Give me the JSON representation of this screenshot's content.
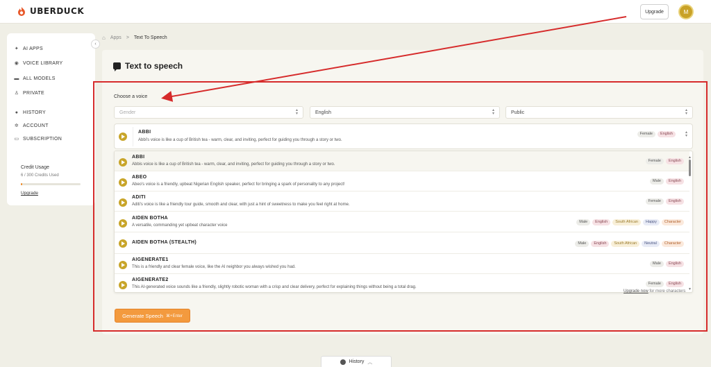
{
  "app": {
    "name": "UBERDUCK"
  },
  "topbar": {
    "upgrade_label": "Upgrade",
    "avatar_initial": "M"
  },
  "sidebar": {
    "items": [
      {
        "label": "AI APPS",
        "icon": "sparkle-icon"
      },
      {
        "label": "VOICE LIBRARY",
        "icon": "eye-icon"
      },
      {
        "label": "ALL MODELS",
        "icon": "folder-icon"
      },
      {
        "label": "PRIVATE",
        "icon": "user-icon"
      },
      {
        "label": "HISTORY",
        "icon": "clock-icon"
      },
      {
        "label": "ACCOUNT",
        "icon": "gear-icon"
      },
      {
        "label": "SUBSCRIPTION",
        "icon": "card-icon"
      }
    ],
    "credit_title": "Credit Usage",
    "credit_used": "6 / 300 Credits Used",
    "credit_fraction": 0.02,
    "upgrade_link": "Upgrade"
  },
  "breadcrumb": {
    "root": "Apps",
    "separator": ">",
    "current": "Text To Speech"
  },
  "page": {
    "title": "Text to speech",
    "choose_voice_label": "Choose a voice"
  },
  "filters": {
    "gender": {
      "placeholder": "Gender"
    },
    "language": {
      "value": "English"
    },
    "visibility": {
      "value": "Public"
    }
  },
  "selected_voice": {
    "name": "ABBI",
    "description": "Abbi's voice is like a cup of British tea - warm, clear, and inviting, perfect for guiding you through a story or two.",
    "tags": [
      {
        "text": "Female",
        "kind": "gender"
      },
      {
        "text": "English",
        "kind": "lang"
      }
    ]
  },
  "voices": [
    {
      "name": "ABBI",
      "description": "Abbis voice is like a cup of British tea - warm, clear, and inviting, perfect for guiding you through a story or two.",
      "tags": [
        {
          "text": "Female",
          "kind": "gender"
        },
        {
          "text": "English",
          "kind": "lang"
        }
      ]
    },
    {
      "name": "ABEO",
      "description": "Abeo's voice is a friendly, upbeat Nigerian English speaker, perfect for bringing a spark of personality to any project!",
      "tags": [
        {
          "text": "Male",
          "kind": "gender"
        },
        {
          "text": "English",
          "kind": "lang"
        }
      ]
    },
    {
      "name": "ADITI",
      "description": "Aditi's voice is like a friendly tour guide, smooth and clear, with just a hint of sweetness to make you feel right at home.",
      "tags": [
        {
          "text": "Female",
          "kind": "gender"
        },
        {
          "text": "English",
          "kind": "lang"
        }
      ]
    },
    {
      "name": "AIDEN BOTHA",
      "description": "A versatile, commanding yet upbeat character voice",
      "tags": [
        {
          "text": "Male",
          "kind": "gender"
        },
        {
          "text": "English",
          "kind": "lang"
        },
        {
          "text": "South African",
          "kind": "accent"
        },
        {
          "text": "Happy",
          "kind": "style"
        },
        {
          "text": "Character",
          "kind": "char"
        }
      ]
    },
    {
      "name": "AIDEN BOTHA (STEALTH)",
      "description": "",
      "tags": [
        {
          "text": "Male",
          "kind": "gender"
        },
        {
          "text": "English",
          "kind": "lang"
        },
        {
          "text": "South African",
          "kind": "accent"
        },
        {
          "text": "Neutral",
          "kind": "style"
        },
        {
          "text": "Character",
          "kind": "char"
        }
      ]
    },
    {
      "name": "AIGENERATE1",
      "description": "This is a friendly and clear female voice, like the AI neighbor you always wished you had.",
      "tags": [
        {
          "text": "Male",
          "kind": "gender"
        },
        {
          "text": "English",
          "kind": "lang"
        }
      ]
    },
    {
      "name": "AIGENERATE2",
      "description": "This AI-generated voice sounds like a friendly, slightly robotic woman with a crisp and clear delivery, perfect for explaining things without being a total drag.",
      "tags": [
        {
          "text": "Female",
          "kind": "gender"
        },
        {
          "text": "English",
          "kind": "lang"
        }
      ]
    }
  ],
  "upgrade_note": {
    "link": "Upgrade now",
    "text": " for more characters"
  },
  "generate": {
    "label": "Generate Speech",
    "shortcut": "⌘+Enter"
  },
  "history_tab": {
    "label": "History"
  },
  "colors": {
    "accent": "#f39a3e",
    "play": "#c8a52a",
    "annotation": "#d62b2b"
  }
}
